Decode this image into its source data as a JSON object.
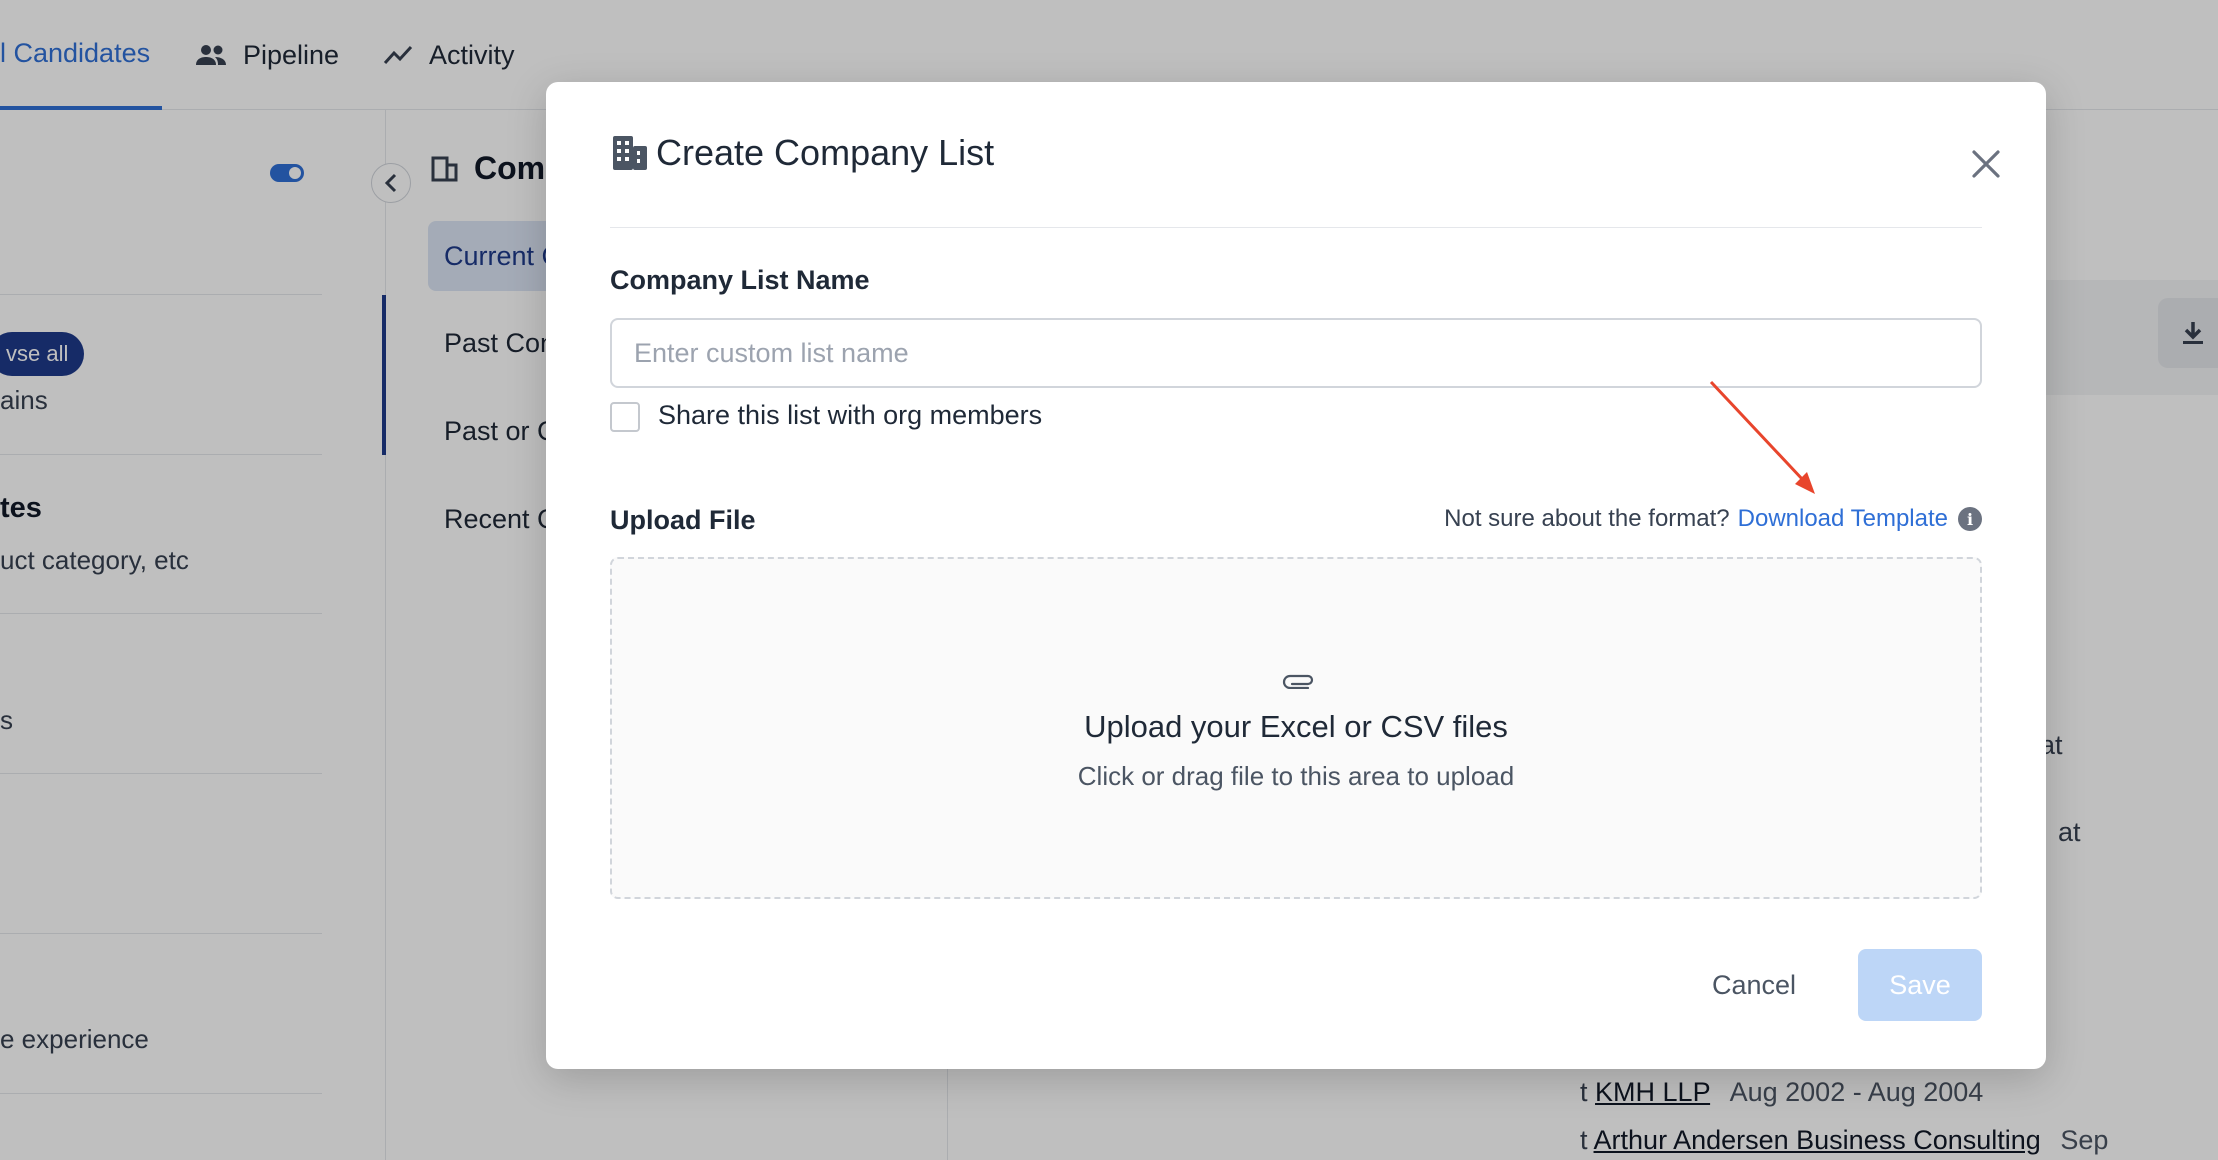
{
  "nav": {
    "tabs": [
      {
        "label": "l Candidates",
        "icon": "candidates-icon",
        "active": true
      },
      {
        "label": "Pipeline",
        "icon": "people-icon"
      },
      {
        "label": "Activity",
        "icon": "trend-icon"
      }
    ]
  },
  "left_panel": {
    "browse_all": "vse all",
    "domains_text": "ains",
    "heading": "tes",
    "product_text": "uct category, etc",
    "s_text": "s",
    "experience_text": "e experience"
  },
  "mid_panel": {
    "title": "Comp",
    "items": [
      "Current C",
      "Past Con",
      "Past or C",
      "Recent C"
    ]
  },
  "right_panel": {
    "at1": "at",
    "at2": "at",
    "company1": "KMH LLP",
    "date1": "Aug 2002 - Aug 2004",
    "company2": "Arthur Andersen Business Consulting",
    "date2": "Sep",
    "prefix": "t"
  },
  "modal": {
    "title": "Create Company List",
    "name_label": "Company List Name",
    "name_placeholder": "Enter custom list name",
    "name_value": "",
    "share_label": "Share this list with org members",
    "share_checked": false,
    "upload_label": "Upload File",
    "format_hint": "Not sure about the format?",
    "template_link": "Download Template",
    "dropzone_title": "Upload your Excel or CSV files",
    "dropzone_sub": "Click or drag file to this area to upload",
    "cancel_label": "Cancel",
    "save_label": "Save"
  },
  "colors": {
    "accent": "#2f6fd6",
    "save_disabled": "#bdd6f7",
    "annotation_arrow": "#e8452c"
  }
}
